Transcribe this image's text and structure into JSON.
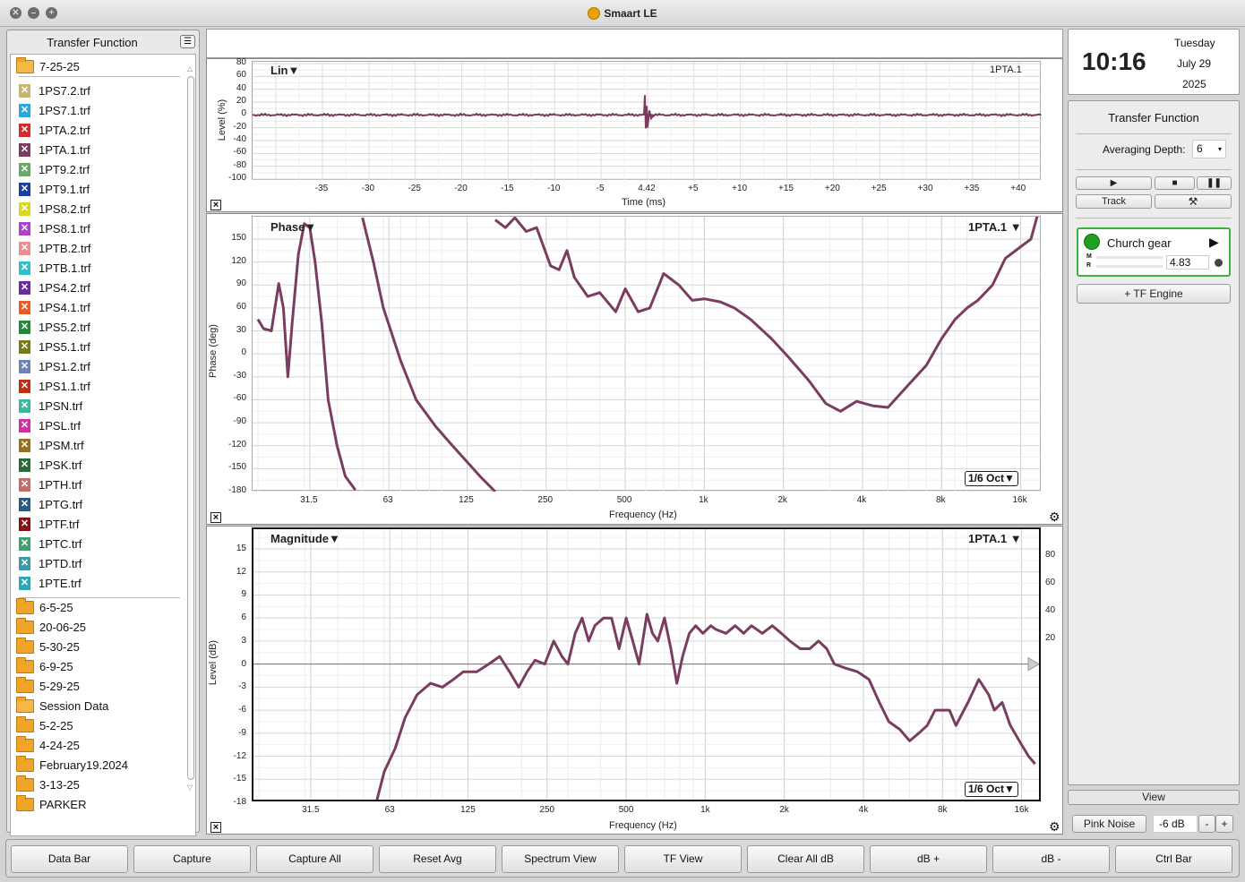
{
  "window": {
    "title": "Smaart LE"
  },
  "sidebar": {
    "title": "Transfer Function",
    "current_folder": "7-25-25",
    "files": [
      {
        "name": "1PS7.2.trf",
        "color": "#c8b46e"
      },
      {
        "name": "1PS7.1.trf",
        "color": "#27a8e0"
      },
      {
        "name": "1PTA.2.trf",
        "color": "#d42a2a"
      },
      {
        "name": "1PTA.1.trf",
        "color": "#7b3c64"
      },
      {
        "name": "1PT9.2.trf",
        "color": "#6aa86a"
      },
      {
        "name": "1PT9.1.trf",
        "color": "#1a3ea8"
      },
      {
        "name": "1PS8.2.trf",
        "color": "#d8d820"
      },
      {
        "name": "1PS8.1.trf",
        "color": "#b040d0"
      },
      {
        "name": "1PTB.2.trf",
        "color": "#f08c8c"
      },
      {
        "name": "1PTB.1.trf",
        "color": "#30c0c8"
      },
      {
        "name": "1PS4.2.trf",
        "color": "#6a2aa0"
      },
      {
        "name": "1PS4.1.trf",
        "color": "#e85a28"
      },
      {
        "name": "1PS5.2.trf",
        "color": "#1e8a3a"
      },
      {
        "name": "1PS5.1.trf",
        "color": "#7a7a18"
      },
      {
        "name": "1PS1.2.trf",
        "color": "#7080b8"
      },
      {
        "name": "1PS1.1.trf",
        "color": "#c03010"
      },
      {
        "name": "1PSN.trf",
        "color": "#3ab8a0"
      },
      {
        "name": "1PSL.trf",
        "color": "#d030a0"
      },
      {
        "name": "1PSM.trf",
        "color": "#9a7020"
      },
      {
        "name": "1PSK.trf",
        "color": "#2a6a3a"
      },
      {
        "name": "1PTH.trf",
        "color": "#c86a6a"
      },
      {
        "name": "1PTG.trf",
        "color": "#2a5a8a"
      },
      {
        "name": "1PTF.trf",
        "color": "#8a1010"
      },
      {
        "name": "1PTC.trf",
        "color": "#40a070"
      },
      {
        "name": "1PTD.trf",
        "color": "#3a9aa8"
      },
      {
        "name": "1PTE.trf",
        "color": "#2aa8b8"
      }
    ],
    "folders": [
      "6-5-25",
      "20-06-25",
      "5-30-25",
      "6-9-25",
      "5-29-25",
      "Session Data",
      "5-2-25",
      "4-24-25",
      "February19.2024",
      "3-13-25",
      "PARKER"
    ]
  },
  "impulse": {
    "title": "Lin▼",
    "trace": "1PTA.1",
    "ylabel": "Level (%)",
    "xlabel": "Time (ms)",
    "yticks": [
      "80",
      "60",
      "40",
      "20",
      "0",
      "-20",
      "-40",
      "-60",
      "-80",
      "-100"
    ],
    "xticks": [
      "-35",
      "-30",
      "-25",
      "-20",
      "-15",
      "-10",
      "-5",
      "4.42",
      "+5",
      "+10",
      "+15",
      "+20",
      "+25",
      "+30",
      "+35",
      "+40"
    ]
  },
  "phase": {
    "title": "Phase▼",
    "trace": "1PTA.1 ▼",
    "ylabel": "Phase (deg)",
    "xlabel": "Frequency (Hz)",
    "smoothing": "1/6 Oct▼",
    "yticks": [
      "150",
      "120",
      "90",
      "60",
      "30",
      "0",
      "-30",
      "-60",
      "-90",
      "-120",
      "-150",
      "-180"
    ],
    "xticks": [
      "31.5",
      "63",
      "125",
      "250",
      "500",
      "1k",
      "2k",
      "4k",
      "8k",
      "16k"
    ]
  },
  "magnitude": {
    "title": "Magnitude▼",
    "trace": "1PTA.1 ▼",
    "ylabel": "Level (dB)",
    "xlabel": "Frequency (Hz)",
    "smoothing": "1/6 Oct▼",
    "yticks": [
      "15",
      "12",
      "9",
      "6",
      "3",
      "0",
      "-3",
      "-6",
      "-9",
      "-12",
      "-15",
      "-18"
    ],
    "yticks_right": [
      "80",
      "60",
      "40",
      "20"
    ],
    "xticks": [
      "31.5",
      "63",
      "125",
      "250",
      "500",
      "1k",
      "2k",
      "4k",
      "8k",
      "16k"
    ]
  },
  "clock": {
    "time": "10:16",
    "day": "Tuesday",
    "date": "July 29",
    "year": "2025"
  },
  "control": {
    "title": "Transfer Function",
    "avg_label": "Averaging Depth:",
    "avg_value": "6",
    "track_label": "Track",
    "tf_name": "Church gear",
    "meter_m": "M",
    "meter_r": "R",
    "delay_value": "4.83",
    "add_engine": "+ TF Engine",
    "view_label": "View",
    "pink_noise": "Pink Noise",
    "noise_level": "-6 dB",
    "minus": "-",
    "plus": "+"
  },
  "bottom_buttons": [
    "Data Bar",
    "Capture",
    "Capture All",
    "Reset Avg",
    "Spectrum View",
    "TF View",
    "Clear All dB",
    "dB +",
    "dB -",
    "Ctrl Bar"
  ],
  "colors": {
    "trace": "#7a3d60",
    "accent_green": "#20a020"
  }
}
